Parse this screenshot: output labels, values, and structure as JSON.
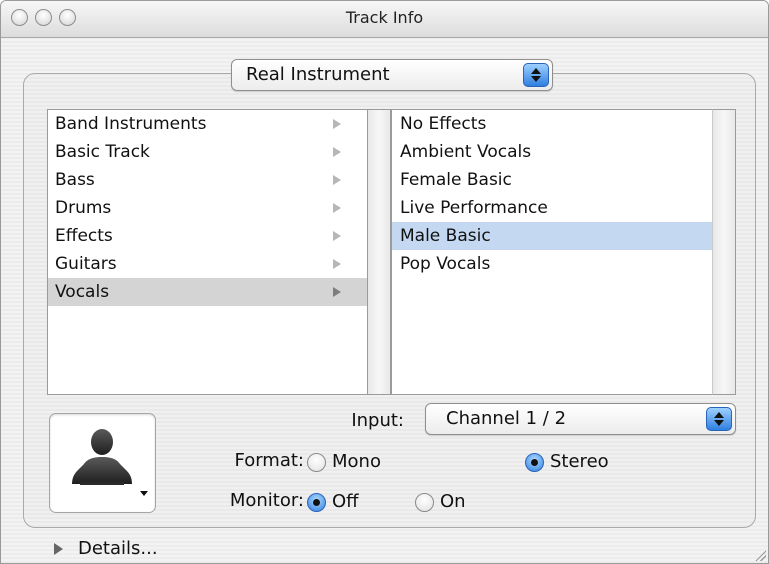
{
  "window": {
    "title": "Track Info"
  },
  "instrument_type": {
    "selected": "Real Instrument"
  },
  "categories": [
    {
      "label": "Band Instruments"
    },
    {
      "label": "Basic Track"
    },
    {
      "label": "Bass"
    },
    {
      "label": "Drums"
    },
    {
      "label": "Effects"
    },
    {
      "label": "Guitars"
    },
    {
      "label": "Vocals"
    }
  ],
  "categories_selected": "Vocals",
  "presets": [
    {
      "label": "No Effects"
    },
    {
      "label": "Ambient Vocals"
    },
    {
      "label": "Female Basic"
    },
    {
      "label": "Live Performance"
    },
    {
      "label": "Male Basic"
    },
    {
      "label": "Pop Vocals"
    }
  ],
  "presets_selected": "Male Basic",
  "settings": {
    "input_label": "Input:",
    "input_value": "Channel 1 / 2",
    "format_label": "Format:",
    "format_options": [
      "Mono",
      "Stereo"
    ],
    "format_selected": "Stereo",
    "monitor_label": "Monitor:",
    "monitor_options": [
      "Off",
      "On"
    ],
    "monitor_selected": "Off"
  },
  "details": {
    "label": "Details..."
  },
  "colors": {
    "selection_blue": "#c4d9f1",
    "selection_gray": "#d4d4d4",
    "accent": "#2f7fe0"
  },
  "icons": {
    "track_icon": "person-silhouette-icon"
  }
}
